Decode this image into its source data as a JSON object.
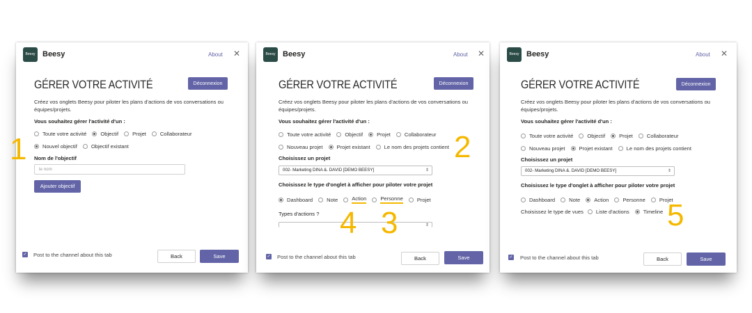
{
  "app": {
    "name": "Beesy",
    "logo_text": "Beesy",
    "about": "About",
    "close_icon": "close-icon"
  },
  "common": {
    "title": "GÉRER VOTRE ACTIVITÉ",
    "logout": "Déconnexion",
    "description": "Créez vos onglets Beesy pour piloter les plans d'actions de vos conversations ou équipes/projets.",
    "manage_label": "Vous souhaitez gérer l'activité d'un :",
    "manage_options": [
      "Toute votre activité",
      "Objectif",
      "Projet",
      "Collaborateur"
    ],
    "post_channel": "Post to the channel about this tab",
    "back": "Back",
    "save": "Save"
  },
  "panel1": {
    "selected_manage": "Objectif",
    "mode_options": [
      "Nouvel objectif",
      "Objectif existant"
    ],
    "name_label": "Nom de l'objectif",
    "name_placeholder": "le nom",
    "add_button": "Ajouter objectif",
    "callout": "1"
  },
  "panel2": {
    "project_options": [
      "Nouveau projet",
      "Projet existant",
      "Le nom des projets contient"
    ],
    "choose_project_label": "Choisissez un projet",
    "project_value": "002- Marketing DINA &. DAVID [DEMO BEESY]",
    "tab_type_label": "Choisissez le type d'onglet à afficher pour piloter votre projet",
    "tab_types": [
      "Dashboard",
      "Note",
      "Action",
      "Personne",
      "Projet"
    ],
    "action_types_label": "Types d'actions ?",
    "callouts": [
      "2",
      "4",
      "3"
    ]
  },
  "panel3": {
    "project_value": "002- Marketing DINA &. DAVID [DEMO BEESY]",
    "view_type_label": "Choisissez le type de vues",
    "view_types": [
      "Liste d'actions",
      "Timeline"
    ],
    "callout": "5"
  },
  "colors": {
    "accent": "#6264a7",
    "logo_bg": "#2b4b47",
    "callout": "#f5b800"
  }
}
